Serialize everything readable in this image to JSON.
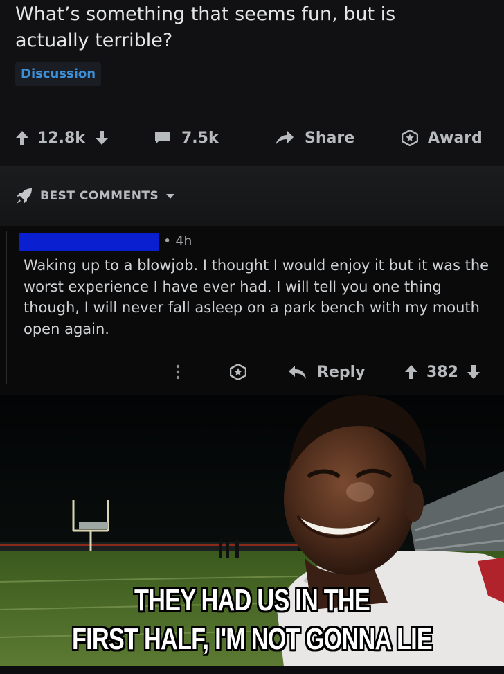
{
  "post": {
    "title": "What’s something that seems fun, but is actually terrible?",
    "flair": "Discussion",
    "upvotes": "12.8k",
    "comments": "7.5k",
    "share_label": "Share",
    "award_label": "Award"
  },
  "sort": {
    "label": "BEST COMMENTS"
  },
  "comment": {
    "age": "• 4h",
    "body": "Waking up to a blowjob. I thought I would enjoy it but it was the worst experience I have ever had. I will tell you one thing though, I will never fall asleep on a park bench with my mouth open again.",
    "reply_label": "Reply",
    "score": "382"
  },
  "meme": {
    "caption_line1": "THEY HAD US IN THE",
    "caption_line2": "FIRST HALF, I'M NOT GONNA LIE"
  },
  "colors": {
    "background": "#0b0b0c",
    "text": "#d7dadc",
    "flair_text": "#3d8fd6",
    "redaction": "#0a1fd0"
  },
  "icons": [
    "arrow-up-icon",
    "arrow-down-icon",
    "comment-icon",
    "share-icon",
    "award-icon",
    "more-icon",
    "reply-icon",
    "rocket-icon",
    "caret-down-icon"
  ]
}
